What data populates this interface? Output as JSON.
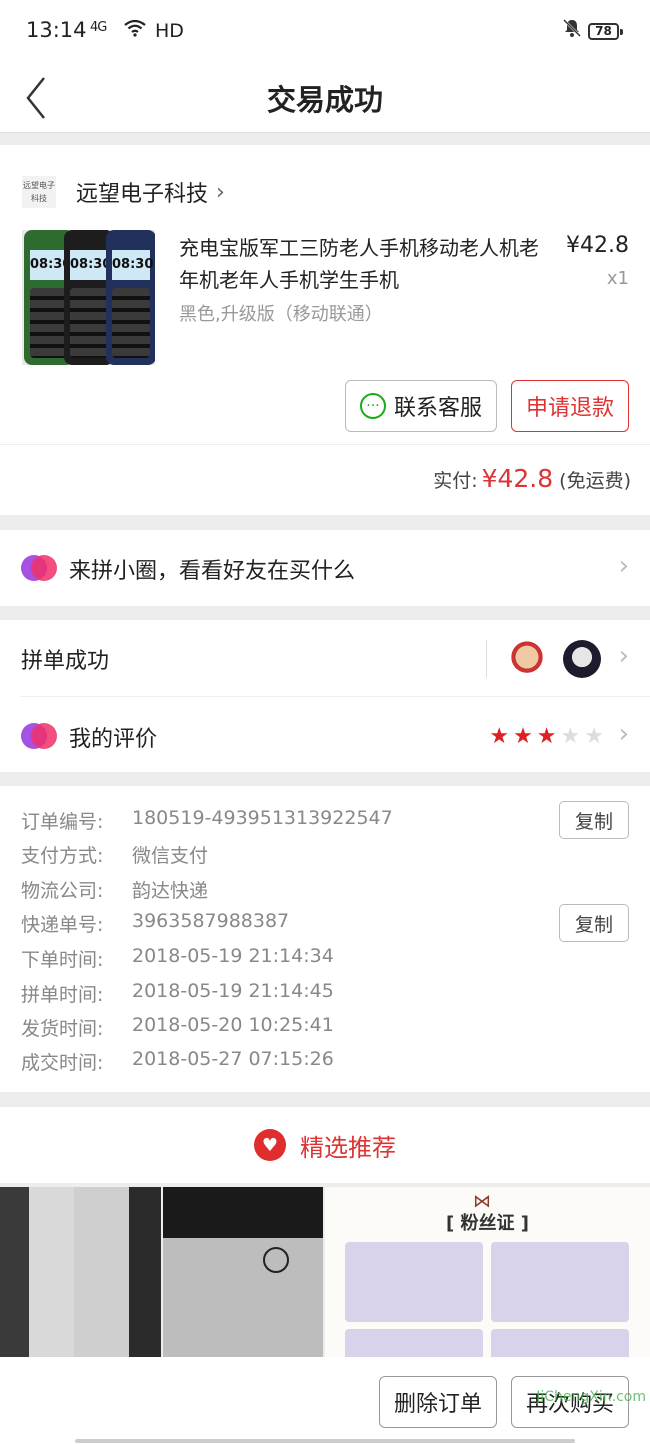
{
  "status_bar": {
    "time": "13:14",
    "signal": "4G",
    "hd": "HD",
    "battery": "78"
  },
  "nav": {
    "title": "交易成功"
  },
  "order": {
    "shop_logo_text": "远望电子科技",
    "shop_name": "远望电子科技",
    "product_title": "充电宝版军工三防老人手机移动老人机老年机老年人手机学生手机",
    "product_spec": "黑色,升级版（移动联通）",
    "price": "¥42.8",
    "quantity": "x1",
    "phone_screen_time": "08:30",
    "contact_label": "联系客服",
    "refund_label": "申请退款",
    "paid_label": "实付:",
    "paid_amount": "¥42.8",
    "paid_note": "(免运费)"
  },
  "circle": {
    "label": "来拼小圈，看看好友在买什么"
  },
  "group": {
    "label": "拼单成功"
  },
  "review": {
    "label": "我的评价",
    "rating": 3,
    "max_rating": 5
  },
  "details": {
    "rows": [
      {
        "label": "订单编号:",
        "value": "180519-493951313922547"
      },
      {
        "label": "支付方式:",
        "value": "微信支付"
      },
      {
        "label": "物流公司:",
        "value": "韵达快递"
      },
      {
        "label": "快递单号:",
        "value": "3963587988387"
      },
      {
        "label": "下单时间:",
        "value": "2018-05-19 21:14:34"
      },
      {
        "label": "拼单时间:",
        "value": "2018-05-19 21:14:45"
      },
      {
        "label": "发货时间:",
        "value": "2018-05-20 10:25:41"
      },
      {
        "label": "成交时间:",
        "value": "2018-05-27 07:15:26"
      }
    ],
    "copy_label": "复制"
  },
  "recommend": {
    "title": "精选推荐",
    "cert_title": "[ 粉丝证 ]"
  },
  "bottom": {
    "delete_label": "删除订单",
    "rebuy_label": "再次购买",
    "watermark": "JiChengXin.com"
  },
  "colors": {
    "accent_red": "#dd3333",
    "wechat_green": "#1aad19"
  }
}
